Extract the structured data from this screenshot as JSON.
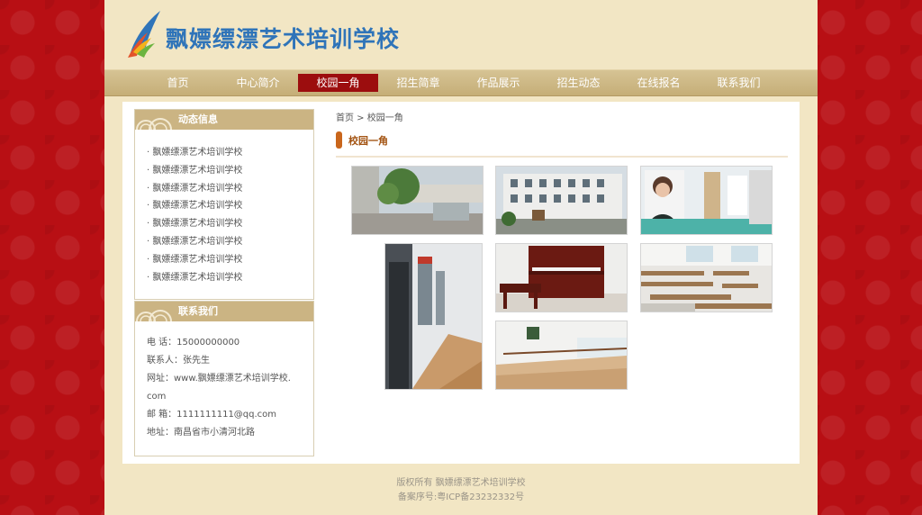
{
  "header": {
    "brand": "飘嫖缥漂艺术培训学校"
  },
  "nav": [
    "首页",
    "中心简介",
    "校园一角",
    "招生简章",
    "作品展示",
    "招生动态",
    "在线报名",
    "联系我们"
  ],
  "sidebar": {
    "news": {
      "title": "动态信息",
      "items": [
        "· 飘嫖缥漂艺术培训学校",
        "· 飘嫖缥漂艺术培训学校",
        "· 飘嫖缥漂艺术培训学校",
        "· 飘嫖缥漂艺术培训学校",
        "· 飘嫖缥漂艺术培训学校",
        "· 飘嫖缥漂艺术培训学校",
        "· 飘嫖缥漂艺术培训学校",
        "· 飘嫖缥漂艺术培训学校"
      ]
    },
    "contact": {
      "title": "联系我们",
      "phone": "电 话：15000000000",
      "person": "联系人：张先生",
      "website": "网址：www.飘嫖缥漂艺术培训学校.com",
      "email": "邮 箱：1111111111@qq.com",
      "address": "地址：南昌省市小清河北路"
    }
  },
  "breadcrumb": "首页 > 校园一角",
  "section_title": "校园一角",
  "footer": {
    "copyright": "版权所有 飘嫖缥漂艺术培训学校",
    "icp": "备案序号:粤ICP备23232332号"
  }
}
